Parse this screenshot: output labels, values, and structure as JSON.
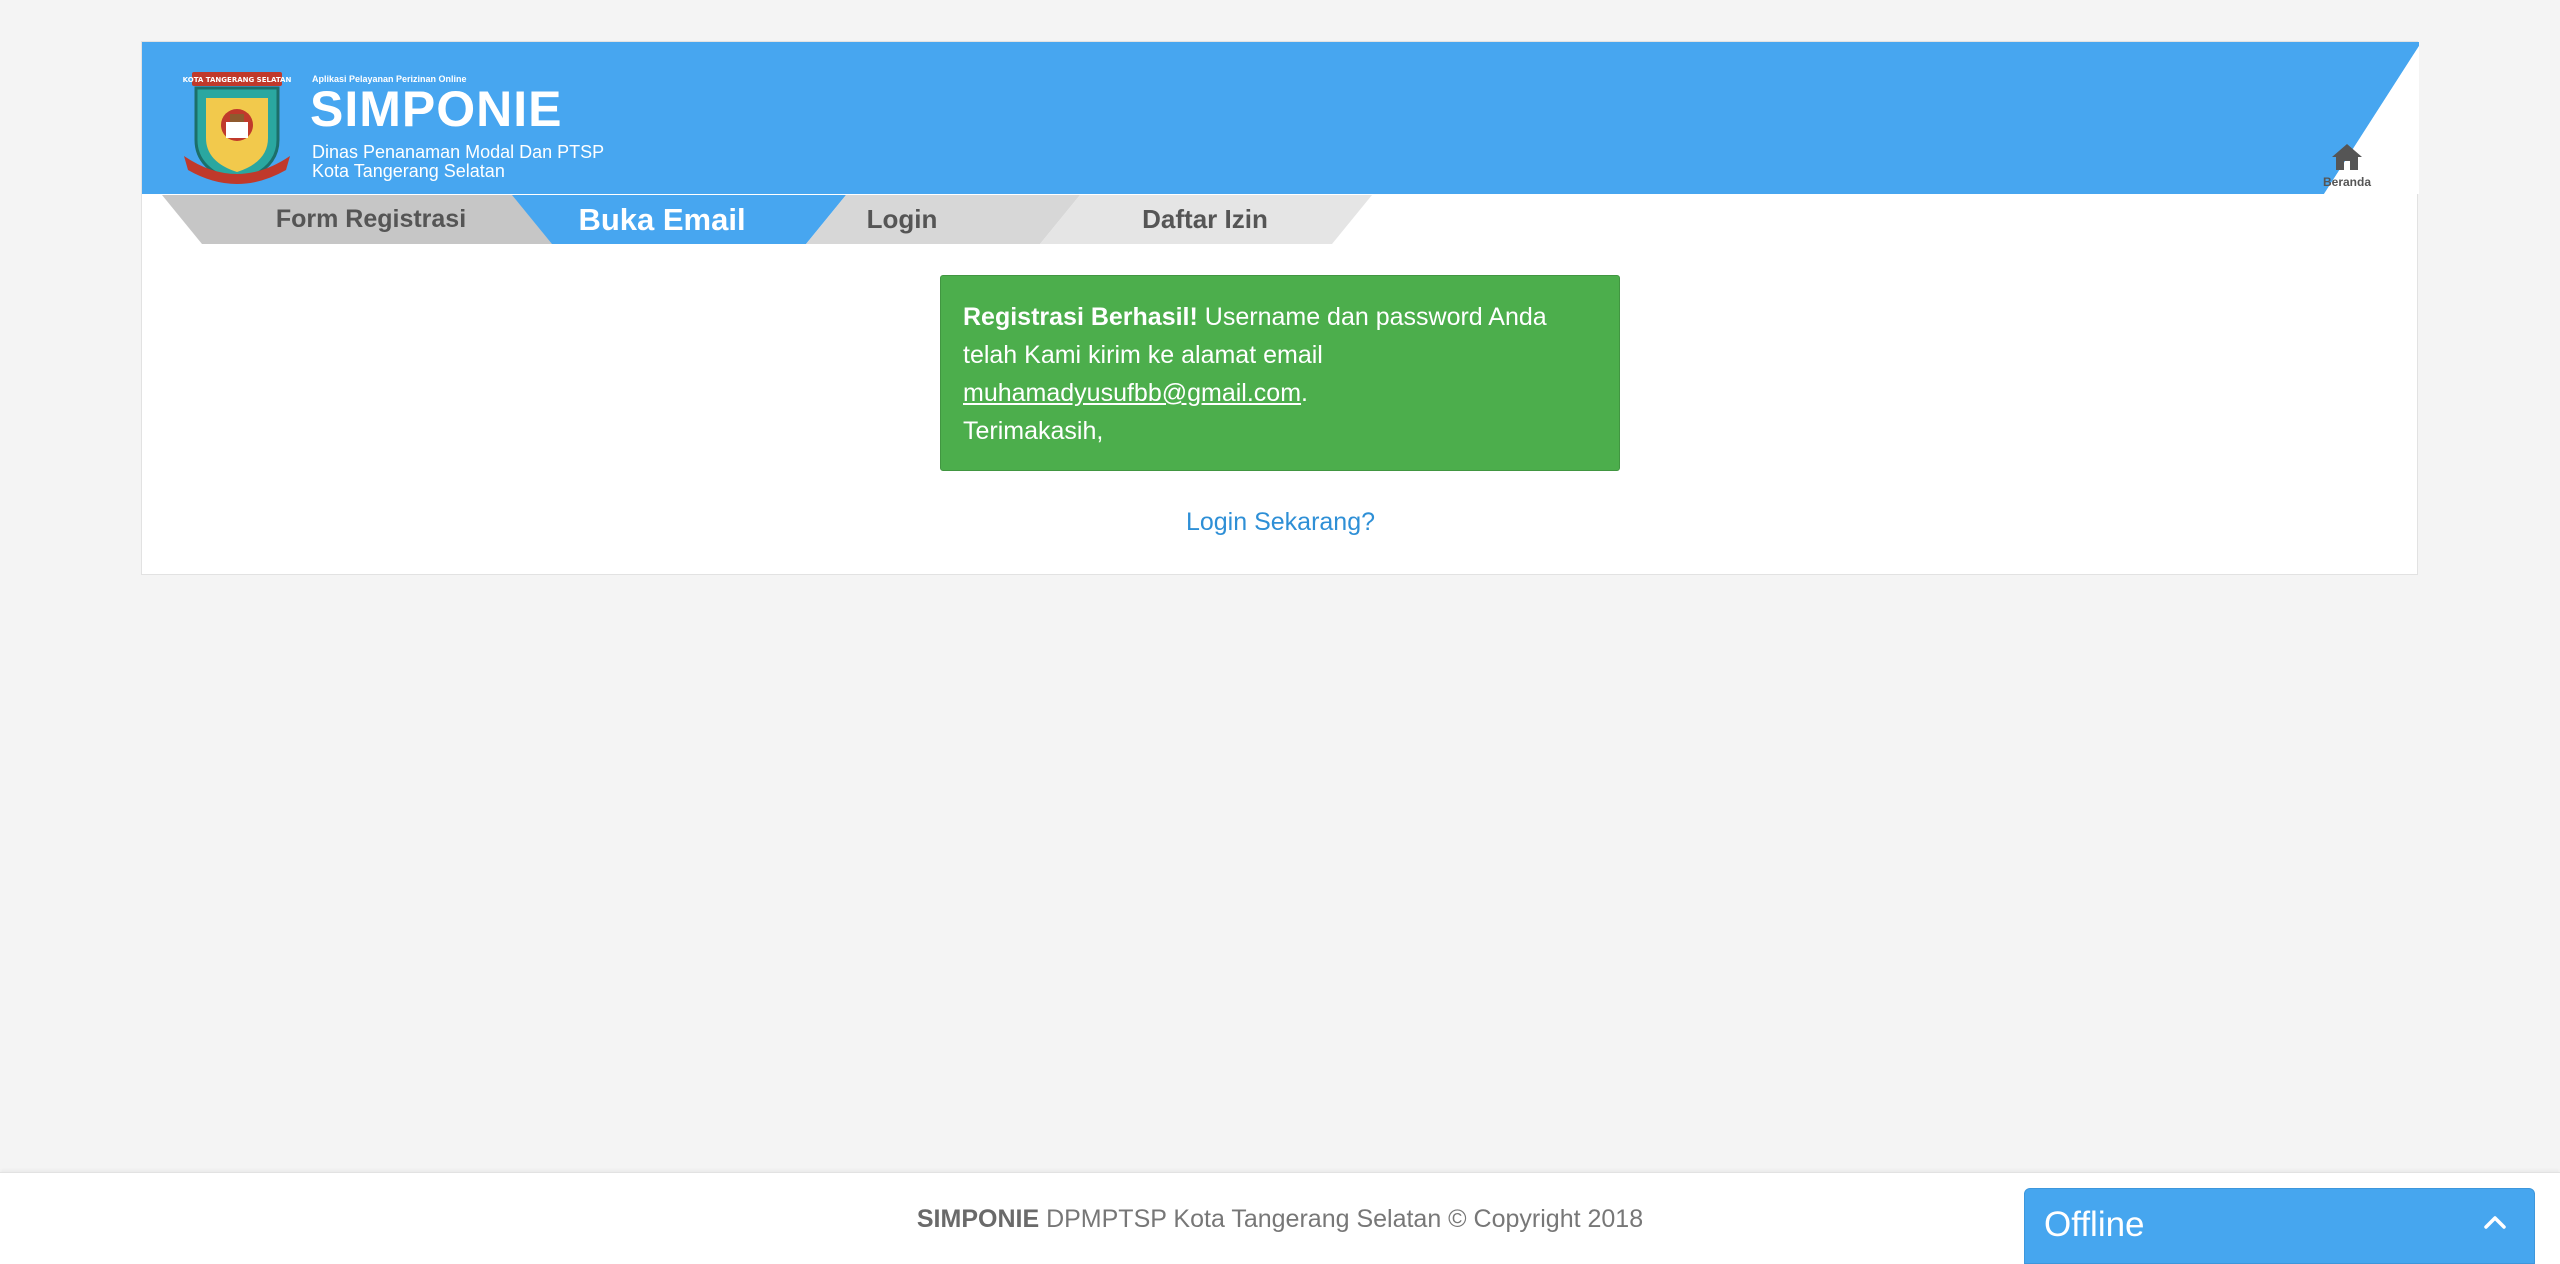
{
  "header": {
    "app_tagline": "Aplikasi Pelayanan Perizinan Online",
    "app_name": "SIMPONIE",
    "agency": "Dinas Penanaman Modal Dan PTSP",
    "city": "Kota Tangerang Selatan",
    "logo_banner": "KOTA TANGERANG SELATAN",
    "home_label": "Beranda",
    "home_icon": "home-icon"
  },
  "steps": [
    {
      "label": "Form Registrasi",
      "state": "done"
    },
    {
      "label": "Buka Email",
      "state": "active"
    },
    {
      "label": "Login",
      "state": "pending"
    },
    {
      "label": "Daftar Izin",
      "state": "pending"
    }
  ],
  "alert": {
    "title": "Registrasi Berhasil!",
    "message": "Username dan password Anda telah Kami kirim ke alamat email",
    "email": "muhamadyusufbb@gmail.com",
    "period": ".",
    "closing": "Terimakasih,"
  },
  "login_link": "Login Sekarang?",
  "footer": {
    "brand": "SIMPONIE",
    "text": "DPMPTSP Kota Tangerang Selatan © Copyright 2018"
  },
  "chat": {
    "status": "Offline",
    "icon": "chevron-up-icon"
  },
  "colors": {
    "header_blue": "#47a6f0",
    "active_tab": "#47a6f0",
    "alert_green": "#4cae4c",
    "link_blue": "#2e8fd6",
    "page_bg": "#f4f4f4"
  }
}
